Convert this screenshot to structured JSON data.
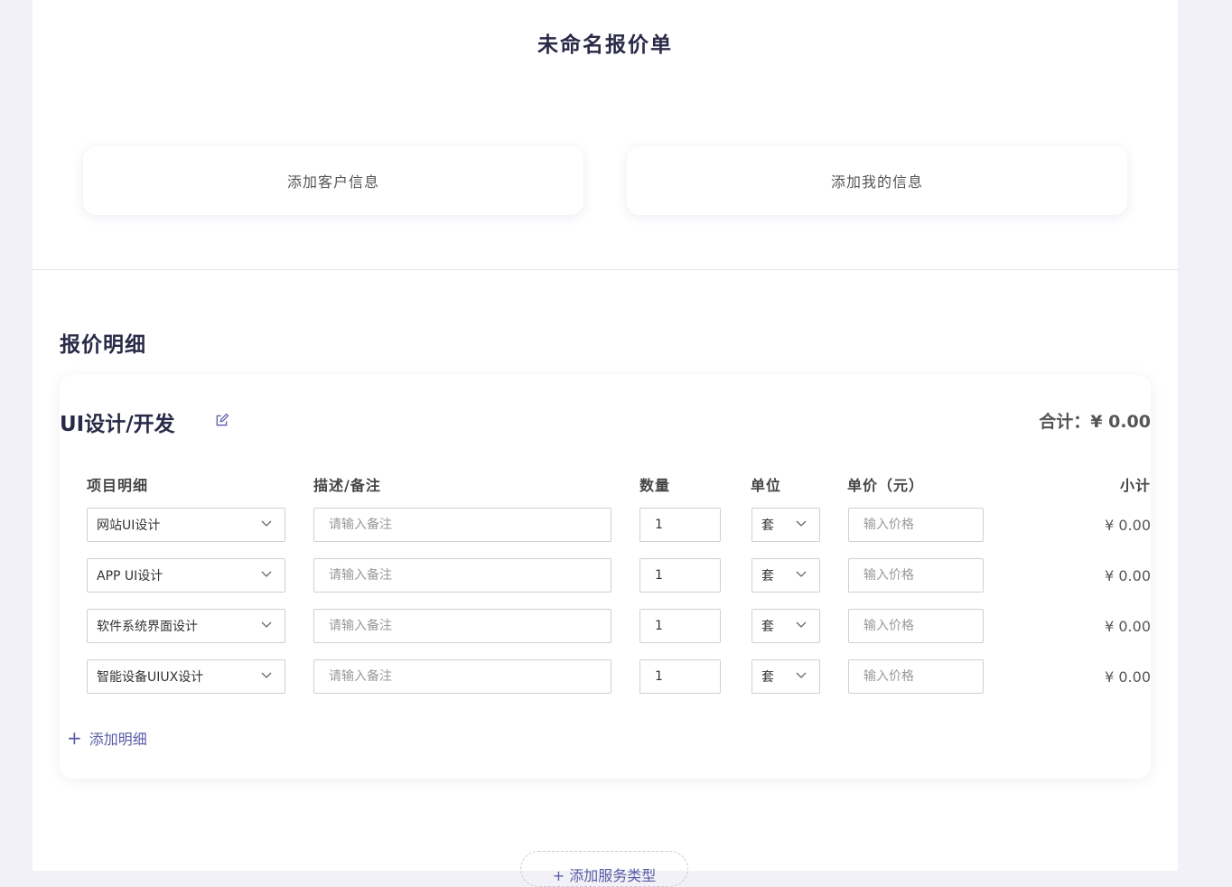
{
  "doc": {
    "title": "未命名报价单"
  },
  "cards": {
    "client": "添加客户信息",
    "me": "添加我的信息"
  },
  "section": {
    "title": "报价明细"
  },
  "group": {
    "name": "UI设计/开发",
    "total_label": "合计：",
    "total_value": "¥ 0.00"
  },
  "columns": {
    "item": "项目明细",
    "desc": "描述/备注",
    "qty": "数量",
    "unit": "单位",
    "price": "单价（元）",
    "subtotal": "小计"
  },
  "rows": [
    {
      "item": "网站UI设计",
      "desc_placeholder": "请输入备注",
      "qty": "1",
      "unit": "套",
      "price_placeholder": "输入价格",
      "subtotal": "¥ 0.00"
    },
    {
      "item": "APP UI设计",
      "desc_placeholder": "请输入备注",
      "qty": "1",
      "unit": "套",
      "price_placeholder": "输入价格",
      "subtotal": "¥ 0.00"
    },
    {
      "item": "软件系统界面设计",
      "desc_placeholder": "请输入备注",
      "qty": "1",
      "unit": "套",
      "price_placeholder": "输入价格",
      "subtotal": "¥ 0.00"
    },
    {
      "item": "智能设备UIUX设计",
      "desc_placeholder": "请输入备注",
      "qty": "1",
      "unit": "套",
      "price_placeholder": "输入价格",
      "subtotal": "¥ 0.00"
    }
  ],
  "actions": {
    "add_line": "添加明细",
    "add_category": "+ 添加服务类型"
  },
  "icons": {
    "edit": "edit-icon",
    "chevron": "chevron-down-icon",
    "plus": "plus-icon"
  },
  "colors": {
    "accent": "#5a5aa6",
    "title": "#2a2a48",
    "background": "#f1f1f7"
  }
}
